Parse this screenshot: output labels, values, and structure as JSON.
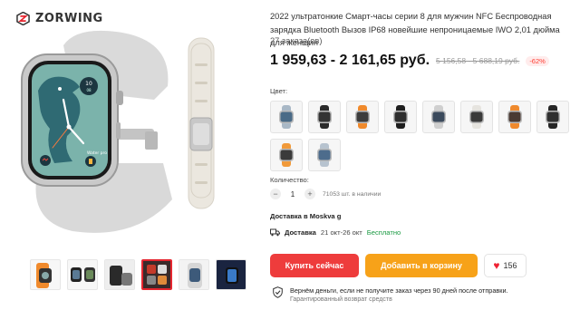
{
  "brand": {
    "name": "ZORWING"
  },
  "product": {
    "title": "2022 ультратонкие Смарт-часы серии 8 для мужчин NFC Беспроводная зарядка Bluetooth Вызов IP68 новейшие непроницаемые IWO 2,01 дюйма для женщин",
    "orders": "27 заказа(ов)",
    "price": "1 959,63 - 2 161,65 руб.",
    "old_price": "5 156,58 - 5 688,19 руб.",
    "discount": "-62%"
  },
  "hero": {
    "time_value": "10",
    "time_unit": "08",
    "strap_label": "Water pro"
  },
  "colors": {
    "label": "Цвет:",
    "options": [
      {
        "name": "blue-grey",
        "strap": "#a9b8c6",
        "face": "#4a6b87"
      },
      {
        "name": "black",
        "strap": "#2a2a2a",
        "face": "#333333"
      },
      {
        "name": "orange",
        "strap": "#f08a2c",
        "face": "#3c3c3c"
      },
      {
        "name": "black-2",
        "strap": "#1f1f1f",
        "face": "#2e2e2e"
      },
      {
        "name": "silver",
        "strap": "#cfcfcf",
        "face": "#3b4a5c"
      },
      {
        "name": "white",
        "strap": "#e6e4df",
        "face": "#3a3a3a"
      },
      {
        "name": "orange-2",
        "strap": "#ef8a2e",
        "face": "#4a3a33"
      },
      {
        "name": "black-3",
        "strap": "#262626",
        "face": "#303030"
      },
      {
        "name": "orange-3",
        "strap": "#f19a3a",
        "face": "#3b3b3b"
      },
      {
        "name": "grey-blue",
        "strap": "#b7c3cf",
        "face": "#4d6c8c"
      }
    ]
  },
  "quantity": {
    "label": "Количество:",
    "minus": "−",
    "value": "1",
    "plus": "+",
    "stock": "71053 шт. в наличии"
  },
  "delivery": {
    "to_prefix": "Доставка в ",
    "region": "Moskva g",
    "label": "Доставка",
    "dates": "21 окт-26 окт",
    "free": "Бесплатно"
  },
  "actions": {
    "buy": "Купить сейчас",
    "cart": "Добавить в корзину",
    "wishlist_count": "156"
  },
  "guarantee": {
    "main": "Вернём деньги, если не получите заказ через 90 дней после отправки.",
    "sub": "Гарантированный возврат средств"
  },
  "theme": {
    "accent_red": "#ee3c3c",
    "accent_orange": "#f7a219",
    "free_green": "#1a9a42"
  }
}
